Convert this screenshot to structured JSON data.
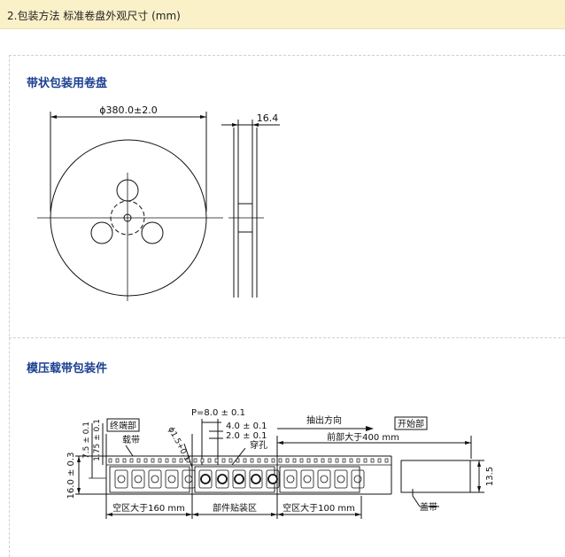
{
  "header": {
    "title": "2.包装方法 标准卷盘外观尺寸 (mm)"
  },
  "reel_section": {
    "title": "带状包装用卷盘",
    "diameter_label": "ϕ380.0±2.0",
    "width_label": "16.4"
  },
  "tape_section": {
    "title": "模压载带包装件",
    "labels": {
      "end_part": "终端部",
      "carrier_tape": "载带",
      "pitch": "P=8.0 ± 0.1",
      "sprocket_pitch": "4.0 ± 0.1",
      "hole_offset": "2.0 ± 0.1",
      "hole_diameter": "ϕ1.5+0.1",
      "perforation": "穿孔",
      "pull_direction": "抽出方向",
      "start_part": "开始部",
      "leader_length": "前部大于400 mm",
      "dim_7_5": "7.5 ± 0.1",
      "dim_1_75": "1.75 ± 0.1",
      "tape_width": "16.0 ± 0.3",
      "cover_width": "13.5",
      "empty_160": "空区大于160 mm",
      "mounted_area": "部件贴装区",
      "empty_100": "空区大于100 mm",
      "cover_tape": "盖带"
    }
  }
}
